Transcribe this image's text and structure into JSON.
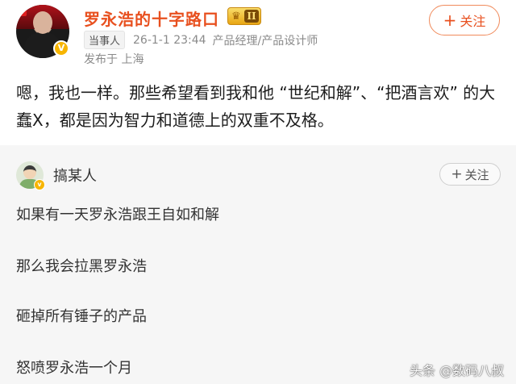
{
  "post": {
    "author": "罗永浩的十字路口",
    "level_badge": "II",
    "follow_label": "关注",
    "follow_plus": "+",
    "tag": "当事人",
    "time": "26-1-1 23:44",
    "title_info": "产品经理/产品设计师",
    "location": "发布于 上海",
    "text": "嗯，我也一样。那些希望看到我和他 “世纪和解”、“把酒言欢” 的大蠢X，都是因为智力和道德上的双重不及格。",
    "verify_mark": "V"
  },
  "comment": {
    "author": "搞某人",
    "follow_label": "关注",
    "follow_plus": "+",
    "verify_mark": "v",
    "lines": [
      "如果有一天罗永浩跟王自如和解",
      "那么我会拉黑罗永浩",
      "砸掉所有锤子的产品",
      "怒喷罗永浩一个月"
    ]
  },
  "watermark": "头条 @数码八叔",
  "colors": {
    "brand_orange": "#e8501f",
    "verify_gold": "#f7b500",
    "comment_bg": "#f6f6f6"
  },
  "icons": [
    "crown-icon",
    "plus-icon",
    "verified-icon"
  ]
}
